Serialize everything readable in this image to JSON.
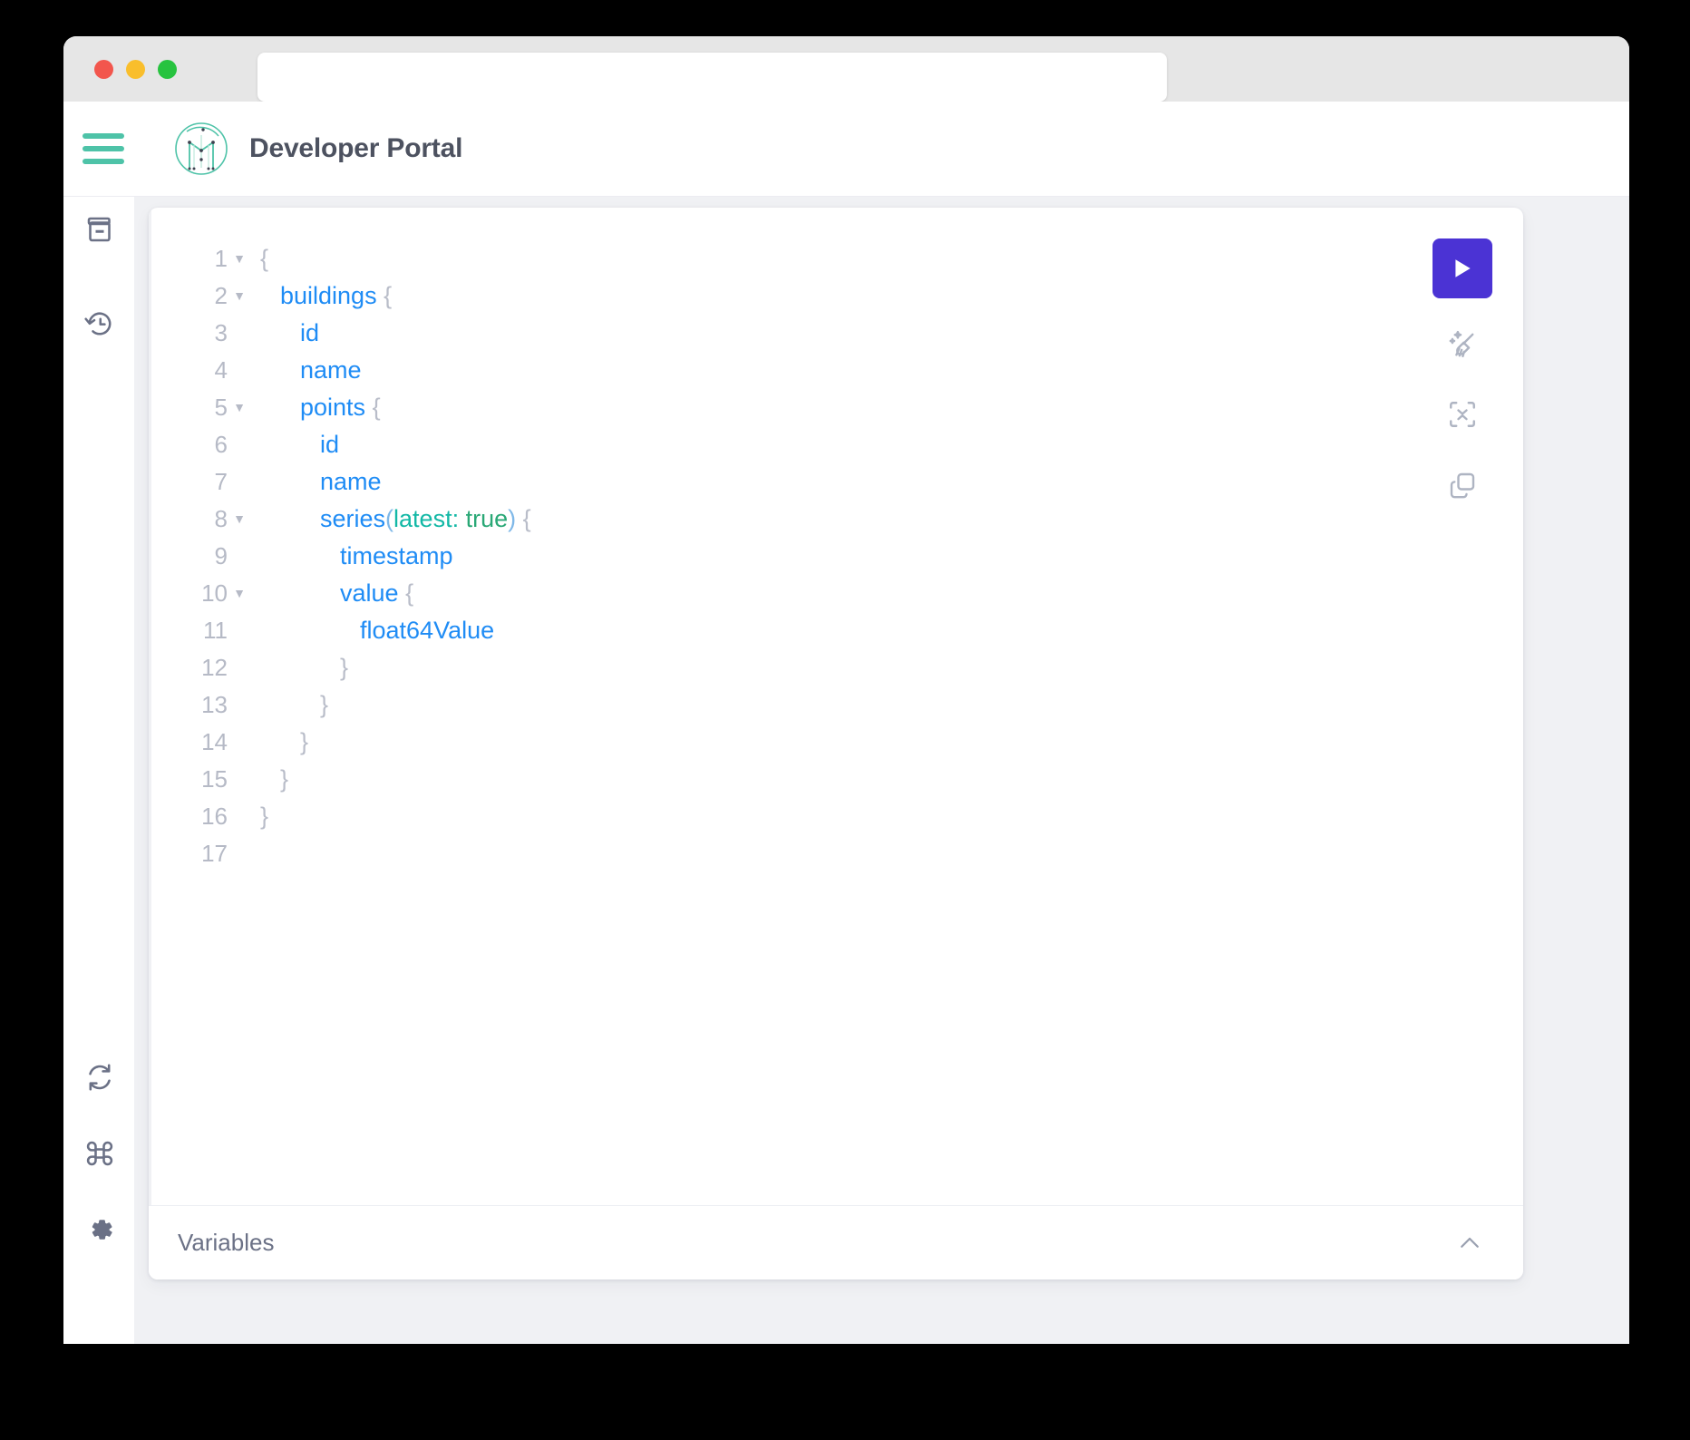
{
  "window": {
    "traffic_lights": [
      {
        "name": "close",
        "color": "#f2564d"
      },
      {
        "name": "minimize",
        "color": "#f9be2c"
      },
      {
        "name": "maximize",
        "color": "#27c33f"
      }
    ],
    "address_bar_value": "",
    "address_bar_placeholder": ""
  },
  "header": {
    "title": "Developer Portal",
    "menu_icon": "hamburger-menu-icon",
    "logo_icon": "brand-logo-icon",
    "accent_color": "#4ec3a8",
    "title_color": "#4d5260"
  },
  "sidebar": {
    "items": [
      {
        "name": "docs",
        "icon": "book-icon",
        "label": "Docs"
      },
      {
        "name": "history",
        "icon": "history-clock-icon",
        "label": "History"
      },
      {
        "name": "refresh",
        "icon": "refresh-icon",
        "label": "Refresh"
      },
      {
        "name": "shortcuts",
        "icon": "command-key-icon",
        "label": "Shortcuts"
      },
      {
        "name": "settings",
        "icon": "gear-icon",
        "label": "Settings"
      }
    ]
  },
  "editor": {
    "language": "graphql",
    "total_lines": 17,
    "lines": [
      {
        "number": "1",
        "foldable": true,
        "tokens": [
          {
            "t": "{",
            "c": "punct"
          }
        ],
        "indent": 0
      },
      {
        "number": "2",
        "foldable": true,
        "tokens": [
          {
            "t": "buildings ",
            "c": "field"
          },
          {
            "t": "{",
            "c": "punct"
          }
        ],
        "indent": 1
      },
      {
        "number": "3",
        "foldable": false,
        "tokens": [
          {
            "t": "id",
            "c": "field"
          }
        ],
        "indent": 2
      },
      {
        "number": "4",
        "foldable": false,
        "tokens": [
          {
            "t": "name",
            "c": "field"
          }
        ],
        "indent": 2
      },
      {
        "number": "5",
        "foldable": true,
        "tokens": [
          {
            "t": "points ",
            "c": "field"
          },
          {
            "t": "{",
            "c": "punct"
          }
        ],
        "indent": 2
      },
      {
        "number": "6",
        "foldable": false,
        "tokens": [
          {
            "t": "id",
            "c": "field"
          }
        ],
        "indent": 3
      },
      {
        "number": "7",
        "foldable": false,
        "tokens": [
          {
            "t": "name",
            "c": "field"
          }
        ],
        "indent": 3
      },
      {
        "number": "8",
        "foldable": true,
        "tokens": [
          {
            "t": "series",
            "c": "field"
          },
          {
            "t": "(",
            "c": "paren"
          },
          {
            "t": "latest: ",
            "c": "arg"
          },
          {
            "t": "true",
            "c": "bool"
          },
          {
            "t": ")",
            "c": "paren"
          },
          {
            "t": " {",
            "c": "punct"
          }
        ],
        "indent": 3
      },
      {
        "number": "9",
        "foldable": false,
        "tokens": [
          {
            "t": "timestamp",
            "c": "field"
          }
        ],
        "indent": 4
      },
      {
        "number": "10",
        "foldable": true,
        "tokens": [
          {
            "t": "value ",
            "c": "field"
          },
          {
            "t": "{",
            "c": "punct"
          }
        ],
        "indent": 4
      },
      {
        "number": "11",
        "foldable": false,
        "tokens": [
          {
            "t": "float64Value",
            "c": "field"
          }
        ],
        "indent": 5
      },
      {
        "number": "12",
        "foldable": false,
        "tokens": [
          {
            "t": "}",
            "c": "punct"
          }
        ],
        "indent": 4
      },
      {
        "number": "13",
        "foldable": false,
        "tokens": [
          {
            "t": "}",
            "c": "punct"
          }
        ],
        "indent": 3
      },
      {
        "number": "14",
        "foldable": false,
        "tokens": [
          {
            "t": "}",
            "c": "punct"
          }
        ],
        "indent": 2
      },
      {
        "number": "15",
        "foldable": false,
        "tokens": [
          {
            "t": "}",
            "c": "punct"
          }
        ],
        "indent": 1
      },
      {
        "number": "16",
        "foldable": false,
        "tokens": [
          {
            "t": "}",
            "c": "punct"
          }
        ],
        "indent": 0
      },
      {
        "number": "17",
        "foldable": false,
        "tokens": [],
        "indent": 0
      }
    ],
    "toolbar": [
      {
        "name": "run-query",
        "icon": "play-icon",
        "label": "Execute Query",
        "primary": true,
        "color": "#4b33d4"
      },
      {
        "name": "prettify",
        "icon": "broom-sparkle-icon",
        "label": "Prettify"
      },
      {
        "name": "merge",
        "icon": "merge-icon",
        "label": "Merge"
      },
      {
        "name": "copy",
        "icon": "copy-icon",
        "label": "Copy"
      }
    ]
  },
  "variables_panel": {
    "label": "Variables",
    "chevron_icon": "chevron-up-icon",
    "expanded": false
  }
}
